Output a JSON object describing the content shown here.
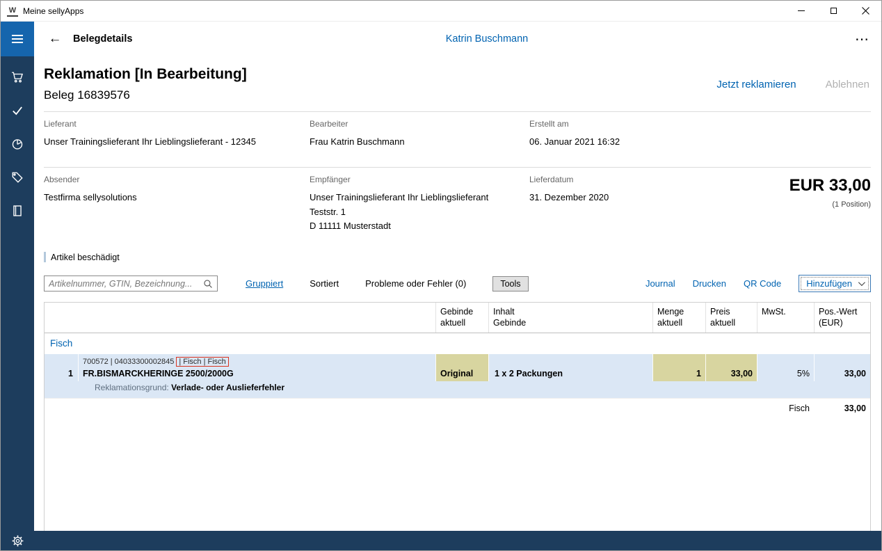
{
  "window": {
    "title": "Meine sellyApps"
  },
  "nav": {
    "title": "Belegdetails",
    "user": "Katrin Buschmann"
  },
  "icons": {
    "back": "←",
    "more": "⋯"
  },
  "header": {
    "title": "Reklamation [In Bearbeitung]",
    "subtitle": "Beleg 16839576",
    "primary_action": "Jetzt reklamieren",
    "secondary_action": "Ablehnen"
  },
  "details": {
    "lieferant_label": "Lieferant",
    "lieferant_value": "Unser Trainingslieferant Ihr Lieblingslieferant - 12345",
    "bearbeiter_label": "Bearbeiter",
    "bearbeiter_value": "Frau Katrin Buschmann",
    "erstellt_label": "Erstellt am",
    "erstellt_value": "06. Januar 2021 16:32",
    "absender_label": "Absender",
    "absender_value": "Testfirma sellysolutions",
    "empfaenger_label": "Empfänger",
    "empfaenger_line1": "Unser Trainingslieferant Ihr Lieblingslieferant",
    "empfaenger_line2": "Teststr. 1",
    "empfaenger_line3": "D 11111 Musterstadt",
    "lieferdatum_label": "Lieferdatum",
    "lieferdatum_value": "31. Dezember 2020",
    "total_value": "EUR 33,00",
    "total_positions": "(1 Position)"
  },
  "status_note": "Artikel beschädigt",
  "toolbar": {
    "search_placeholder": "Artikelnummer, GTIN, Bezeichnung...",
    "gruppiert": "Gruppiert",
    "sortiert": "Sortiert",
    "probleme": "Probleme oder Fehler (0)",
    "tools": "Tools",
    "journal": "Journal",
    "drucken": "Drucken",
    "qr_code": "QR Code",
    "hinzufuegen": "Hinzufügen"
  },
  "table": {
    "columns": {
      "gebinde": "Gebinde\naktuell",
      "inhalt": "Inhalt\nGebinde",
      "menge": "Menge\naktuell",
      "preis": "Preis\naktuell",
      "mwst": "MwSt.",
      "wert": "Pos.-Wert\n(EUR)"
    },
    "group_label": "Fisch",
    "row": {
      "pos": "1",
      "meta": "700572 | 04033300002845",
      "meta_highlight": "| Fisch | Fisch",
      "name": "FR.BISMARCKHERINGE 2500/2000G",
      "gebinde": "Original",
      "inhalt": "1 x 2 Packungen",
      "menge": "1",
      "preis": "33,00",
      "mwst": "5%",
      "wert": "33,00"
    },
    "reason_label": "Reklamationsgrund:",
    "reason_value": " Verlade- oder Auslieferfehler",
    "sum_group": "Fisch",
    "sum_value": "33,00"
  },
  "colors": {
    "accent": "#0063b1",
    "sidebar": "#1d3d5d",
    "hamburger_bg": "#1565ad",
    "row_highlight": "#dbe7f5",
    "cell_highlight": "#d8d5a0",
    "annotation_red": "#d9331f",
    "disabled_text": "#b1b1b1"
  }
}
